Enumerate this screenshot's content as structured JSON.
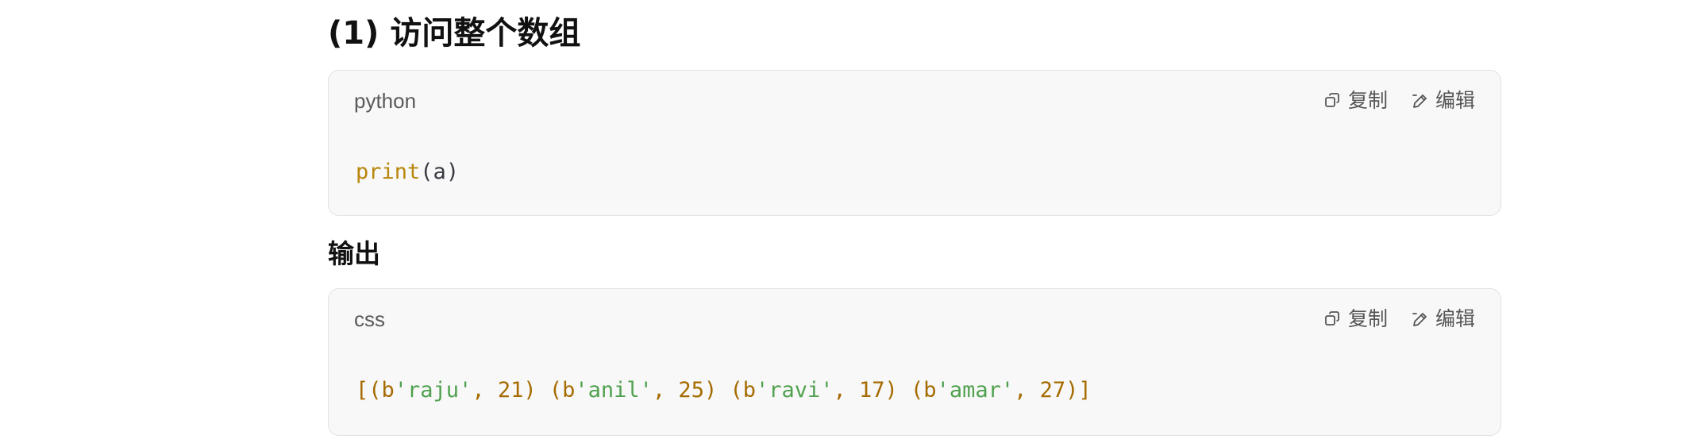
{
  "sections": {
    "heading_main": "(1) 访问整个数组",
    "heading_output": "输出"
  },
  "code_block_1": {
    "language": "python",
    "copy_label": "复制",
    "edit_label": "编辑",
    "code": {
      "fn": "print",
      "open": "(",
      "arg": "a",
      "close": ")"
    }
  },
  "code_block_2": {
    "language": "css",
    "copy_label": "复制",
    "edit_label": "编辑",
    "code_tokens": [
      {
        "t": "[(b",
        "c": "br"
      },
      {
        "t": "'raju'",
        "c": "str"
      },
      {
        "t": ", 21) (b",
        "c": "br"
      },
      {
        "t": "'anil'",
        "c": "str"
      },
      {
        "t": ", 25) (b",
        "c": "br"
      },
      {
        "t": "'ravi'",
        "c": "str"
      },
      {
        "t": ", 17) (b",
        "c": "br"
      },
      {
        "t": "'amar'",
        "c": "str"
      },
      {
        "t": ", 27)]",
        "c": "br"
      }
    ]
  },
  "icons": {
    "copy": "copy-icon",
    "edit": "edit-pen-icon"
  }
}
